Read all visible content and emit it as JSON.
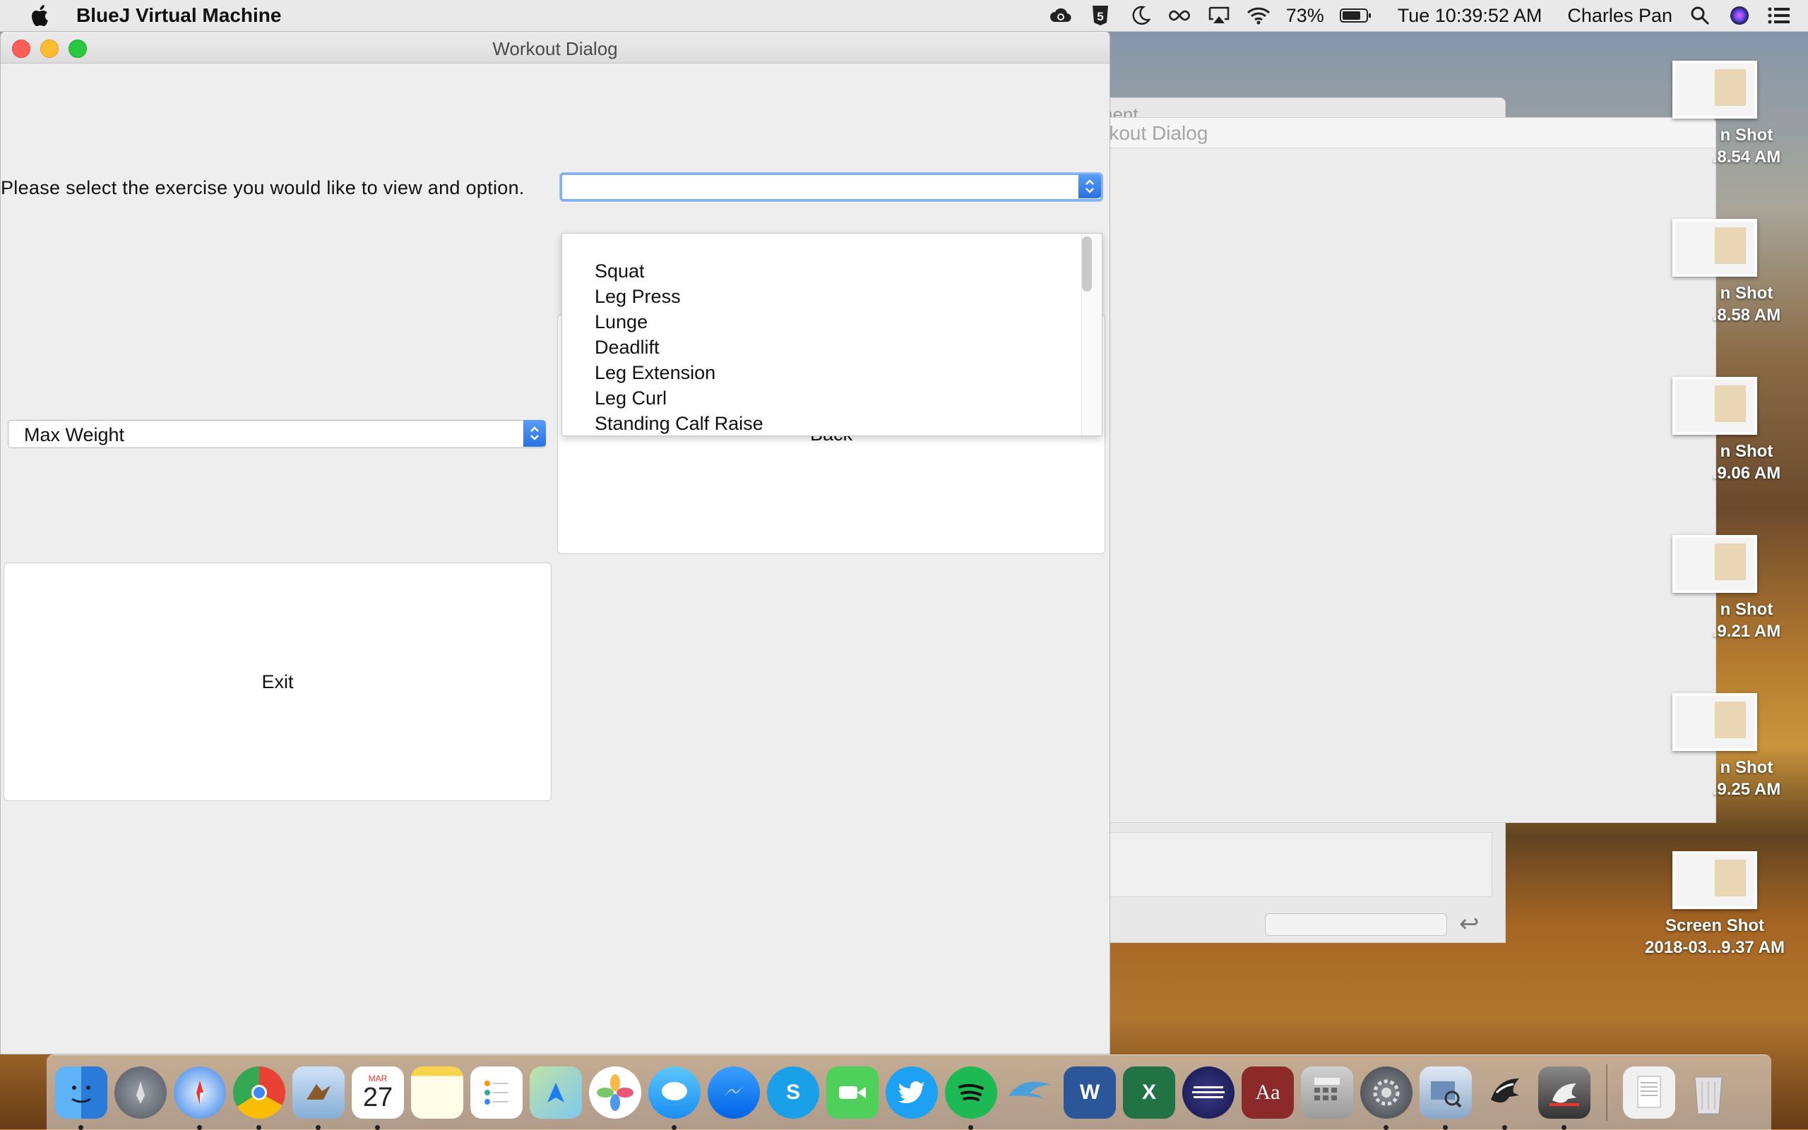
{
  "menubar": {
    "app_name": "BlueJ Virtual Machine",
    "battery": "73%",
    "clock": "Tue 10:39:52 AM",
    "user": "Charles Pan"
  },
  "background_windows": {
    "win1_title": "nent",
    "win2_title": "rkout Dialog"
  },
  "desktop_icons": [
    {
      "line1": "n Shot",
      "line2": ".8.54 AM"
    },
    {
      "line1": "n Shot",
      "line2": ".8.58 AM"
    },
    {
      "line1": "n Shot",
      "line2": ".9.06 AM"
    },
    {
      "line1": "n Shot",
      "line2": ".9.21 AM"
    },
    {
      "line1": "n Shot",
      "line2": ".9.25 AM"
    },
    {
      "line1": "Screen Shot",
      "line2": "2018-03...9.37 AM"
    }
  ],
  "window": {
    "title": "Workout Dialog",
    "prompt": "Please select the exercise you would like to view and option.",
    "exercise_combo_value": "",
    "exercise_options": [
      "Squat",
      "Leg Press",
      "Lunge",
      "Deadlift",
      "Leg Extension",
      "Leg Curl",
      "Standing Calf Raise"
    ],
    "option_combo_value": "Max Weight",
    "back_label": "Back",
    "exit_label": "Exit"
  },
  "dock": {
    "calendar_month": "MAR",
    "calendar_day": "27",
    "apps": [
      "Finder",
      "Launchpad",
      "Safari",
      "Chrome",
      "Mail",
      "Calendar",
      "Notes",
      "Reminders",
      "Maps",
      "Photos",
      "Messages",
      "Messenger",
      "Skype",
      "FaceTime",
      "Twitter",
      "Spotify",
      "Dolphin",
      "Word",
      "Excel",
      "Eclipse",
      "Dictionary",
      "Calculator",
      "System Preferences",
      "Preview",
      "BlueJ",
      "BlueJ Alt",
      "Document",
      "Trash"
    ]
  }
}
